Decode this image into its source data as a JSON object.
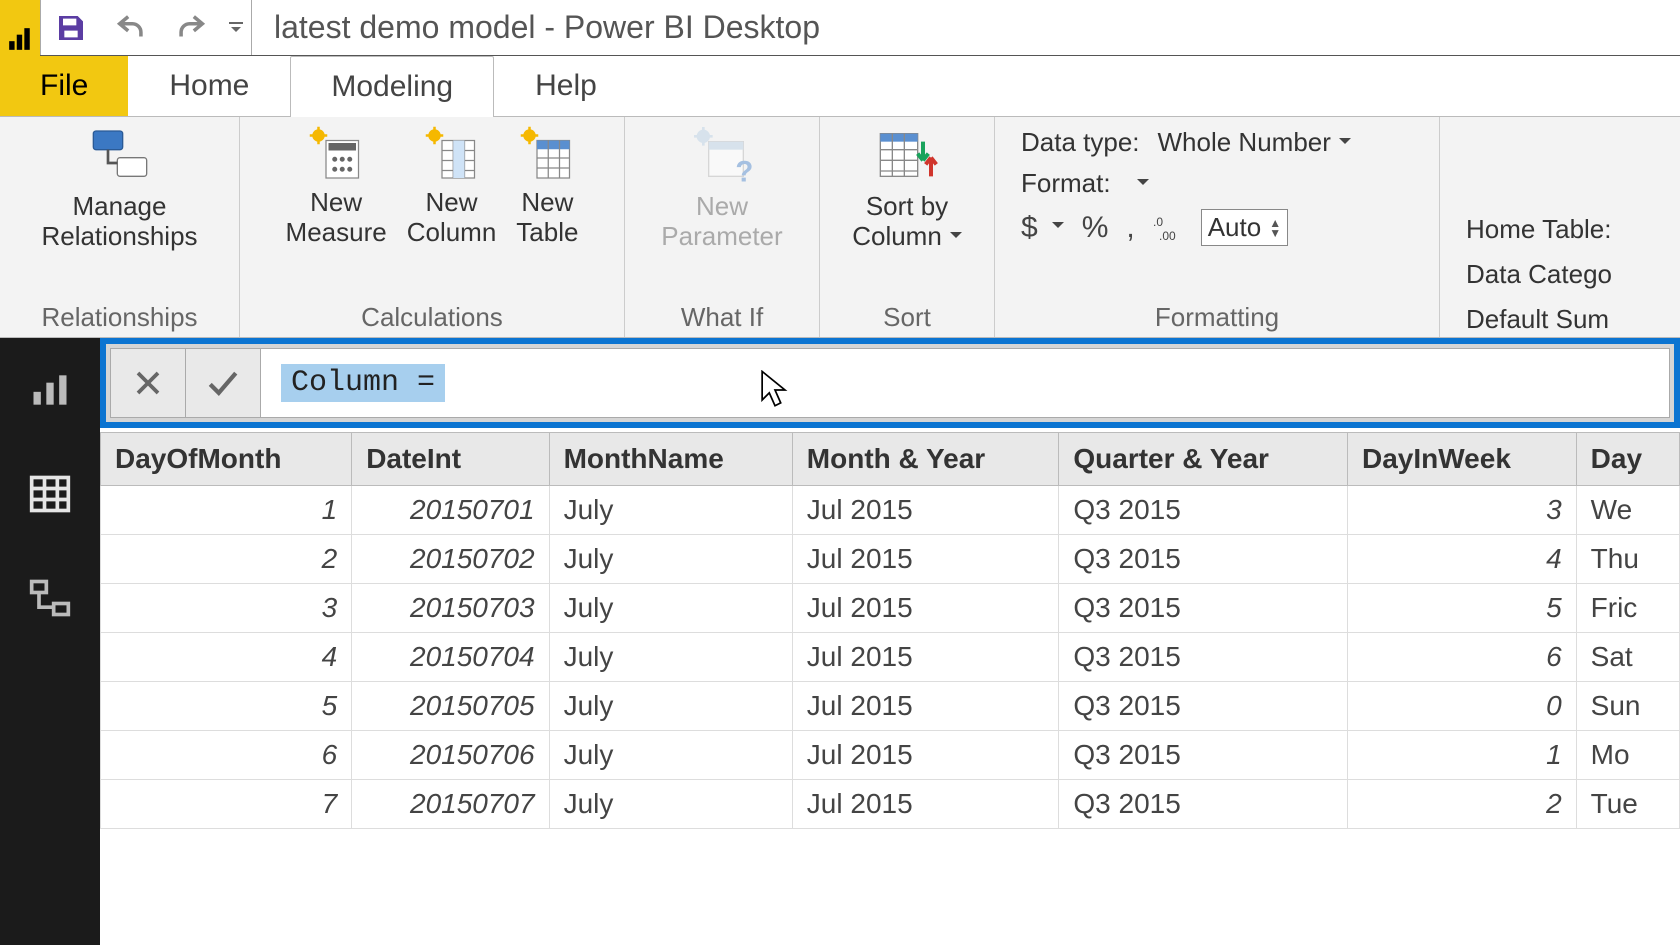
{
  "title_bar": {
    "title": "latest demo model - Power BI Desktop"
  },
  "tabs": {
    "file": "File",
    "home": "Home",
    "modeling": "Modeling",
    "help": "Help",
    "active": "Modeling"
  },
  "ribbon": {
    "relationships": {
      "manage": "Manage\nRelationships",
      "group_label": "Relationships"
    },
    "calculations": {
      "new_measure": "New\nMeasure",
      "new_column": "New\nColumn",
      "new_table": "New\nTable",
      "group_label": "Calculations"
    },
    "what_if": {
      "new_parameter": "New\nParameter",
      "group_label": "What If"
    },
    "sort": {
      "sort_by_column": "Sort by\nColumn",
      "group_label": "Sort"
    },
    "formatting": {
      "data_type_label": "Data type:",
      "data_type_value": "Whole Number",
      "format_label": "Format:",
      "decimal_places": "Auto",
      "group_label": "Formatting"
    },
    "properties": {
      "home_table": "Home Table:",
      "data_category": "Data Catego",
      "default_summ": "Default Sum"
    }
  },
  "formula_bar": {
    "expression": "Column ="
  },
  "columns": [
    "DayOfMonth",
    "DateInt",
    "MonthName",
    "Month & Year",
    "Quarter & Year",
    "DayInWeek",
    "Day"
  ],
  "rows": [
    {
      "DayOfMonth": "1",
      "DateInt": "20150701",
      "MonthName": "July",
      "MonthYear": "Jul 2015",
      "QuarterYear": "Q3 2015",
      "DayInWeek": "3",
      "Day": "We"
    },
    {
      "DayOfMonth": "2",
      "DateInt": "20150702",
      "MonthName": "July",
      "MonthYear": "Jul 2015",
      "QuarterYear": "Q3 2015",
      "DayInWeek": "4",
      "Day": "Thu"
    },
    {
      "DayOfMonth": "3",
      "DateInt": "20150703",
      "MonthName": "July",
      "MonthYear": "Jul 2015",
      "QuarterYear": "Q3 2015",
      "DayInWeek": "5",
      "Day": "Fric"
    },
    {
      "DayOfMonth": "4",
      "DateInt": "20150704",
      "MonthName": "July",
      "MonthYear": "Jul 2015",
      "QuarterYear": "Q3 2015",
      "DayInWeek": "6",
      "Day": "Sat"
    },
    {
      "DayOfMonth": "5",
      "DateInt": "20150705",
      "MonthName": "July",
      "MonthYear": "Jul 2015",
      "QuarterYear": "Q3 2015",
      "DayInWeek": "0",
      "Day": "Sun"
    },
    {
      "DayOfMonth": "6",
      "DateInt": "20150706",
      "MonthName": "July",
      "MonthYear": "Jul 2015",
      "QuarterYear": "Q3 2015",
      "DayInWeek": "1",
      "Day": "Mo"
    },
    {
      "DayOfMonth": "7",
      "DateInt": "20150707",
      "MonthName": "July",
      "MonthYear": "Jul 2015",
      "QuarterYear": "Q3 2015",
      "DayInWeek": "2",
      "Day": "Tue"
    }
  ]
}
